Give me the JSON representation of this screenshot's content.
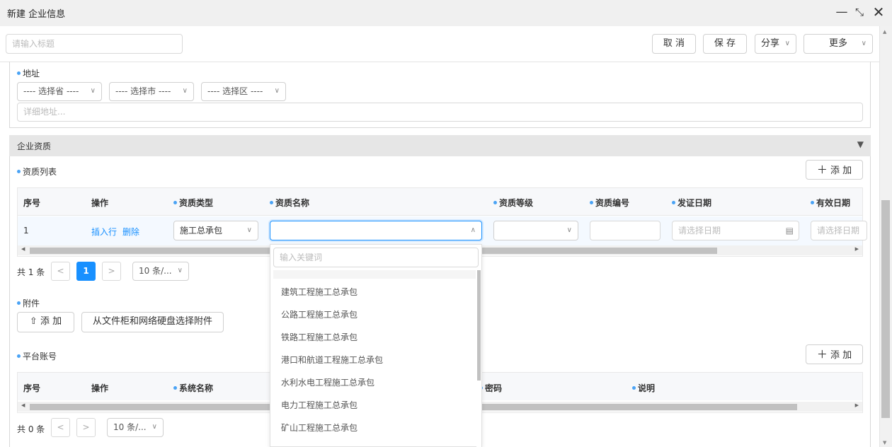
{
  "window": {
    "title": "新建 企业信息"
  },
  "toolbar": {
    "title_placeholder": "请输入标题",
    "cancel": "取 消",
    "save": "保 存",
    "share": "分享",
    "more": "更多"
  },
  "address": {
    "label": "地址",
    "province": "---- 选择省 ----",
    "city": "---- 选择市 ----",
    "district": "---- 选择区 ----",
    "detail_placeholder": "详细地址..."
  },
  "qualification_section": {
    "title": "企业资质"
  },
  "qualification_list": {
    "label": "资质列表",
    "add": "添 加",
    "headers": [
      "序号",
      "操作",
      "资质类型",
      "资质名称",
      "资质等级",
      "资质编号",
      "发证日期",
      "有效日期"
    ],
    "row": {
      "index": "1",
      "insert": "插入行",
      "delete": "删除",
      "type": "施工总承包",
      "issue_placeholder": "请选择日期",
      "valid_placeholder": "请选择日期"
    },
    "total": "共 1 条",
    "page": "1",
    "page_size": "10 条/..."
  },
  "attachments": {
    "label": "附件",
    "add": "添 加",
    "from_cabinet": "从文件柜和网络硬盘选择附件"
  },
  "platform_accounts": {
    "label": "平台账号",
    "add": "添 加",
    "headers": [
      "序号",
      "操作",
      "系统名称",
      "密码",
      "说明"
    ],
    "total": "共 0 条",
    "page_size": "10 条/..."
  },
  "dropdown": {
    "search_placeholder": "输入关键词",
    "options": [
      "建筑工程施工总承包",
      "公路工程施工总承包",
      "铁路工程施工总承包",
      "港口和航道工程施工总承包",
      "水利水电工程施工总承包",
      "电力工程施工总承包",
      "矿山工程施工总承包"
    ]
  },
  "colors": {
    "accent": "#1890ff",
    "dot": "#4aa3f5",
    "section_bg": "#e6e6e6",
    "table_header_bg": "#f7f8fa"
  }
}
